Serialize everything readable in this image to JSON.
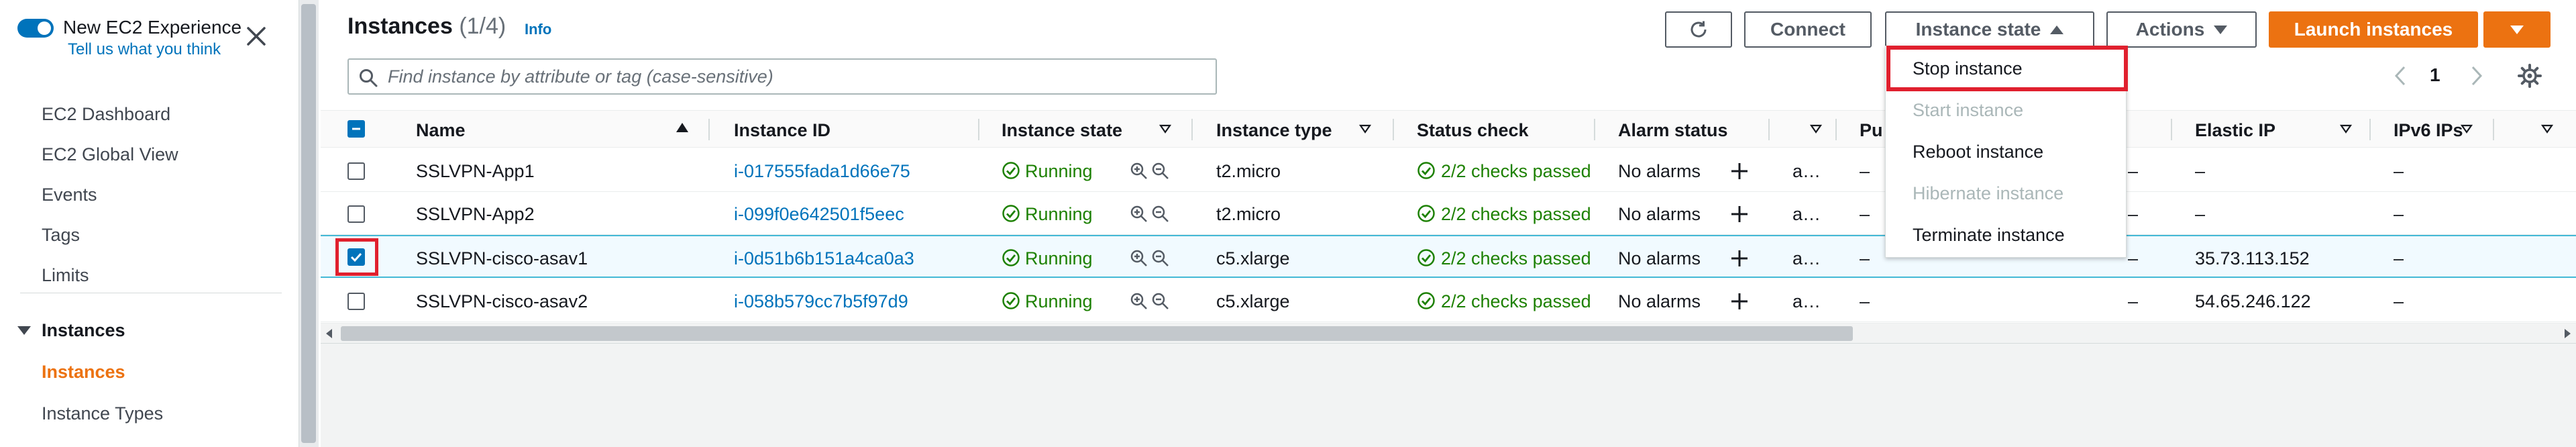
{
  "sidebar": {
    "new_experience_label": "New EC2 Experience",
    "tell_us_link": "Tell us what you think",
    "links": [
      "EC2 Dashboard",
      "EC2 Global View",
      "Events",
      "Tags",
      "Limits"
    ],
    "section_title": "Instances",
    "section_items": [
      "Instances",
      "Instance Types"
    ]
  },
  "header": {
    "title": "Instances",
    "count": "(1/4)",
    "info": "Info",
    "connect": "Connect",
    "instance_state": "Instance state",
    "actions": "Actions",
    "launch": "Launch instances"
  },
  "search": {
    "placeholder": "Find instance by attribute or tag (case-sensitive)"
  },
  "pagination": {
    "current_page": "1"
  },
  "table": {
    "columns": [
      "Name",
      "Instance ID",
      "Instance state",
      "Instance type",
      "Status check",
      "Alarm status",
      "Pu",
      "Elastic IP",
      "IPv6 IPs"
    ],
    "rows": [
      {
        "name": "SSLVPN-App1",
        "id": "i-017555fada1d66e75",
        "state": "Running",
        "type": "t2.micro",
        "status": "2/2 checks passed",
        "alarm": "No alarms",
        "az": "a…",
        "pub": "–",
        "pub2": "–",
        "eip": "–",
        "ipv6": "–",
        "selected": false
      },
      {
        "name": "SSLVPN-App2",
        "id": "i-099f0e642501f5eec",
        "state": "Running",
        "type": "t2.micro",
        "status": "2/2 checks passed",
        "alarm": "No alarms",
        "az": "a…",
        "pub": "–",
        "pub2": "–",
        "eip": "–",
        "ipv6": "–",
        "selected": false
      },
      {
        "name": "SSLVPN-cisco-asav1",
        "id": "i-0d51b6b151a4ca0a3",
        "state": "Running",
        "type": "c5.xlarge",
        "status": "2/2 checks passed",
        "alarm": "No alarms",
        "az": "a…",
        "pub": "–",
        "pub2": "–",
        "eip": "35.73.113.152",
        "ipv6": "–",
        "selected": true
      },
      {
        "name": "SSLVPN-cisco-asav2",
        "id": "i-058b579cc7b5f97d9",
        "state": "Running",
        "type": "c5.xlarge",
        "status": "2/2 checks passed",
        "alarm": "No alarms",
        "az": "a…",
        "pub": "–",
        "pub2": "–",
        "eip": "54.65.246.122",
        "ipv6": "–",
        "selected": false
      }
    ]
  },
  "instance_state_menu": {
    "items": [
      {
        "label": "Stop instance",
        "enabled": true
      },
      {
        "label": "Start instance",
        "enabled": false
      },
      {
        "label": "Reboot instance",
        "enabled": true
      },
      {
        "label": "Hibernate instance",
        "enabled": false
      },
      {
        "label": "Terminate instance",
        "enabled": true
      }
    ]
  },
  "colors": {
    "accent": "#ec7211",
    "link": "#0073bb",
    "success": "#1d8102",
    "highlight": "#e0202e"
  }
}
